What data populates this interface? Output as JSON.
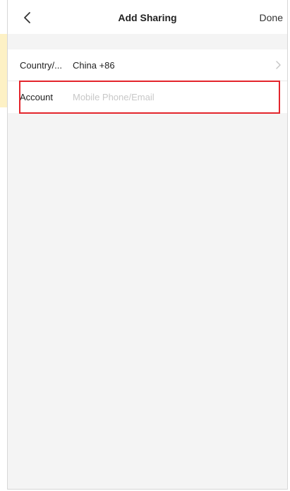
{
  "header": {
    "title": "Add Sharing",
    "done_label": "Done"
  },
  "form": {
    "country": {
      "label": "Country/...",
      "value": "China +86"
    },
    "account": {
      "label": "Account",
      "placeholder": "Mobile Phone/Email",
      "value": ""
    }
  },
  "icons": {
    "back": "chevron-left-icon",
    "country_arrow": "chevron-right-icon"
  },
  "colors": {
    "highlight_border": "#e3252c",
    "accent_strip": "#fdf1c5",
    "page_background": "#f4f4f4"
  }
}
